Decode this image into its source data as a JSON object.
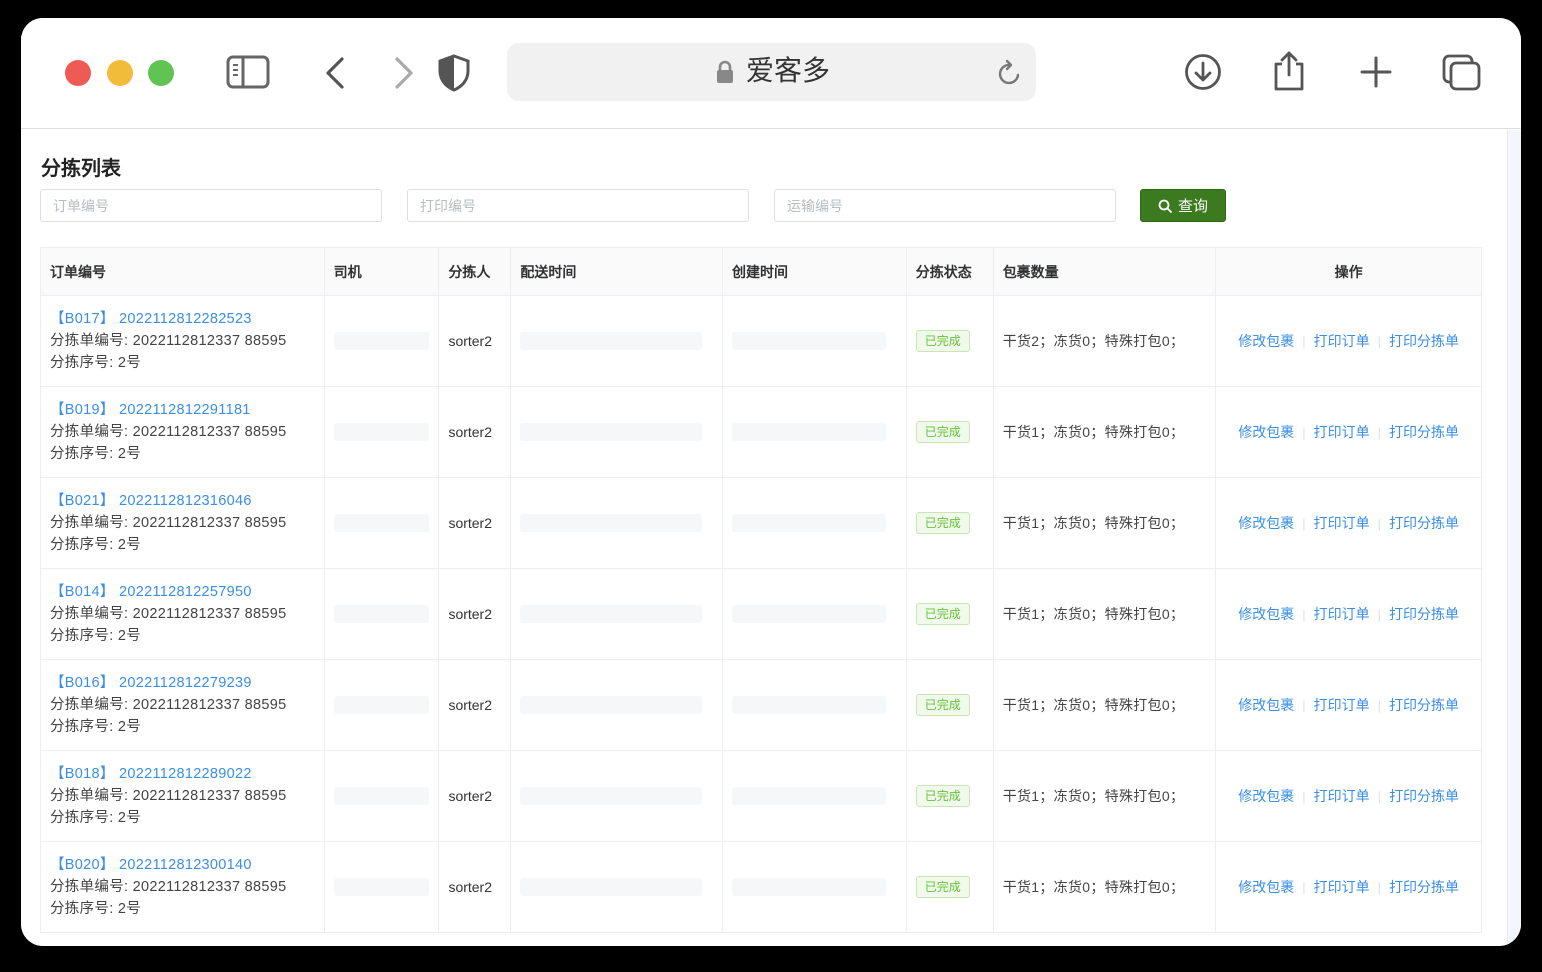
{
  "browser": {
    "site_title": "爱客多"
  },
  "page": {
    "title": "分拣列表"
  },
  "filters": {
    "order_no_placeholder": "订单编号",
    "print_no_placeholder": "打印编号",
    "transport_no_placeholder": "运输编号",
    "search_label": "查询"
  },
  "table": {
    "headers": [
      "订单编号",
      "司机",
      "分拣人",
      "配送时间",
      "创建时间",
      "分拣状态",
      "包裹数量",
      "操作"
    ],
    "actions": [
      "修改包裹",
      "打印订单",
      "打印分拣单"
    ],
    "rows": [
      {
        "order": "【B017】 2022112812282523",
        "sort_no": "分拣单编号: 2022112812337 88595",
        "seq": "分拣序号: 2号",
        "sorter": "sorter2",
        "status": "已完成",
        "packages": "干货2；冻货0；特殊打包0；"
      },
      {
        "order": "【B019】 2022112812291181",
        "sort_no": "分拣单编号: 2022112812337 88595",
        "seq": "分拣序号: 2号",
        "sorter": "sorter2",
        "status": "已完成",
        "packages": "干货1；冻货0；特殊打包0；"
      },
      {
        "order": "【B021】 2022112812316046",
        "sort_no": "分拣单编号: 2022112812337 88595",
        "seq": "分拣序号: 2号",
        "sorter": "sorter2",
        "status": "已完成",
        "packages": "干货1；冻货0；特殊打包0；"
      },
      {
        "order": "【B014】 2022112812257950",
        "sort_no": "分拣单编号: 2022112812337 88595",
        "seq": "分拣序号: 2号",
        "sorter": "sorter2",
        "status": "已完成",
        "packages": "干货1；冻货0；特殊打包0；"
      },
      {
        "order": "【B016】 2022112812279239",
        "sort_no": "分拣单编号: 2022112812337 88595",
        "seq": "分拣序号: 2号",
        "sorter": "sorter2",
        "status": "已完成",
        "packages": "干货1；冻货0；特殊打包0；"
      },
      {
        "order": "【B018】 2022112812289022",
        "sort_no": "分拣单编号: 2022112812337 88595",
        "seq": "分拣序号: 2号",
        "sorter": "sorter2",
        "status": "已完成",
        "packages": "干货1；冻货0；特殊打包0；"
      },
      {
        "order": "【B020】 2022112812300140",
        "sort_no": "分拣单编号: 2022112812337 88595",
        "seq": "分拣序号: 2号",
        "sorter": "sorter2",
        "status": "已完成",
        "packages": "干货1；冻货0；特殊打包0；"
      }
    ]
  }
}
